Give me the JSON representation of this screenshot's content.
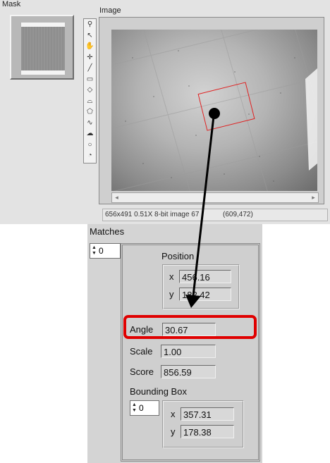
{
  "panels": {
    "mask_label": "Mask",
    "image_label": "Image"
  },
  "tools": [
    {
      "name": "zoom-tool-icon",
      "glyph": "⚲"
    },
    {
      "name": "selection-tool-icon",
      "glyph": "↖"
    },
    {
      "name": "pan-tool-icon",
      "glyph": "✋"
    },
    {
      "name": "point-tool-icon",
      "glyph": "✛"
    },
    {
      "name": "line-tool-icon",
      "glyph": "╱"
    },
    {
      "name": "rectangle-tool-icon",
      "glyph": "▭"
    },
    {
      "name": "rotated-rectangle-tool-icon",
      "glyph": "◇"
    },
    {
      "name": "annulus-tool-icon",
      "glyph": "⌓"
    },
    {
      "name": "polygon-tool-icon",
      "glyph": "⬠"
    },
    {
      "name": "freehand-line-tool-icon",
      "glyph": "∿"
    },
    {
      "name": "freehand-region-tool-icon",
      "glyph": "☁"
    },
    {
      "name": "oval-tool-icon",
      "glyph": "○"
    },
    {
      "name": "arc-tool-icon",
      "glyph": "◔"
    }
  ],
  "status_bar": {
    "info": "656x491 0.51X 8-bit image 67",
    "coords": "(609,472)"
  },
  "matches": {
    "label": "Matches",
    "index": "0",
    "position": {
      "label": "Position",
      "x_label": "x",
      "x_value": "456.16",
      "y_label": "y",
      "y_value": "182.42"
    },
    "angle": {
      "label": "Angle",
      "value": "30.67"
    },
    "scale": {
      "label": "Scale",
      "value": "1.00"
    },
    "score": {
      "label": "Score",
      "value": "856.59"
    },
    "bounding_box": {
      "label": "Bounding Box",
      "index": "0",
      "x_label": "x",
      "x_value": "357.31",
      "y_label": "y",
      "y_value": "178.38"
    }
  },
  "colors": {
    "highlight": "#e00000",
    "roi": "#e02020",
    "arrow": "#000000"
  }
}
